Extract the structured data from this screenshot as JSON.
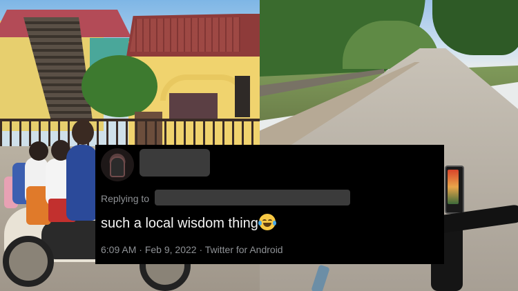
{
  "tweet": {
    "replying_to_label": "Replying to",
    "text": "such a local wisdom thing",
    "emoji_name": "face-with-tears-of-joy",
    "time": "6:09 AM",
    "separator": " · ",
    "date": "Feb 9, 2022",
    "source": "Twitter for Android"
  },
  "photos": {
    "left": {
      "description_icon": "motorbike-photo"
    },
    "right": {
      "description_icon": "road-photo"
    }
  },
  "colors": {
    "tweet_bg": "#000000",
    "text_primary": "#f4f4f4",
    "text_secondary": "#8f9296",
    "redaction": "#3b3b3b"
  }
}
